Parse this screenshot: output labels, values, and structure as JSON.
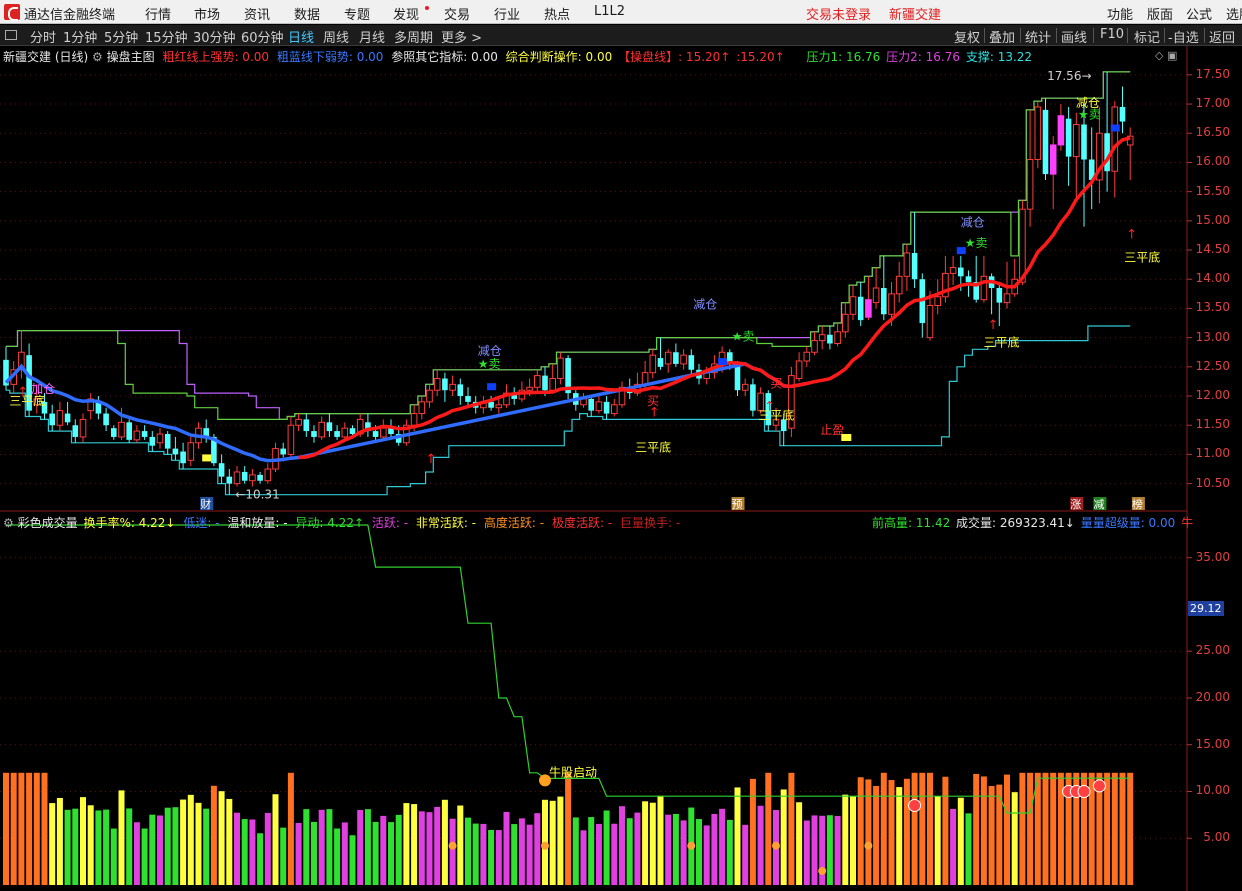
{
  "menu": {
    "app_title": "通达信金融终端",
    "items": [
      "行情",
      "市场",
      "资讯",
      "数据",
      "专题",
      "发现",
      "交易",
      "行业",
      "热点",
      "L1L2"
    ],
    "login_status": "交易未登录",
    "stock_name": "新疆交建",
    "right_items": [
      "功能",
      "版面",
      "公式",
      "选股"
    ]
  },
  "period": {
    "tabs": [
      "分时",
      "1分钟",
      "5分钟",
      "15分钟",
      "30分钟",
      "60分钟",
      "日线",
      "周线",
      "月线",
      "多周期",
      "更多 >"
    ],
    "active": "日线",
    "right_buttons": [
      "复权",
      "叠加",
      "统计",
      "画线",
      "F10",
      "标记",
      "-自选",
      "返回"
    ]
  },
  "main_legend": {
    "stock_title": "新疆交建 (日线)",
    "indicator_name": "操盘主图",
    "items": [
      {
        "text": "粗红线上强势: 0.00",
        "color": "#ff3030"
      },
      {
        "text": "粗蓝线下弱势: 0.00",
        "color": "#3a78ff"
      },
      {
        "text": "参照其它指标: 0.00",
        "color": "#e8e8e8"
      },
      {
        "text": "综合判断操作: 0.00",
        "color": "#ffff40"
      },
      {
        "text": "【操盘线】: 15.20↑",
        "color": "#ff3030"
      },
      {
        "text": ":15.20↑",
        "color": "#ff3030"
      },
      {
        "text": "压力1: 16.76",
        "color": "#30e030"
      },
      {
        "text": "压力2: 16.76",
        "color": "#e040e0"
      },
      {
        "text": "支撑: 13.22",
        "color": "#30e0e0"
      }
    ]
  },
  "price_axis": [
    "17.50",
    "17.00",
    "16.50",
    "16.00",
    "15.50",
    "15.00",
    "14.50",
    "14.00",
    "13.50",
    "13.00",
    "12.50",
    "12.00",
    "11.50",
    "11.00",
    "10.50"
  ],
  "price_range": [
    10.1,
    17.72
  ],
  "candles": [
    [
      12.62,
      12.18,
      12.85,
      12.1
    ],
    [
      12.2,
      12.45,
      12.6,
      12.05
    ],
    [
      12.45,
      12.75,
      13.12,
      12.3
    ],
    [
      12.7,
      11.75,
      12.9,
      11.65
    ],
    [
      11.85,
      11.95,
      12.2,
      11.7
    ],
    [
      11.9,
      11.7,
      12.05,
      11.6
    ],
    [
      11.7,
      11.5,
      11.85,
      11.4
    ],
    [
      11.5,
      11.75,
      11.9,
      11.4
    ],
    [
      11.7,
      11.55,
      11.9,
      11.5
    ],
    [
      11.5,
      11.3,
      11.6,
      11.2
    ],
    [
      11.3,
      11.6,
      11.7,
      11.2
    ],
    [
      11.75,
      11.95,
      12.05,
      11.6
    ],
    [
      11.9,
      11.7,
      12.0,
      11.6
    ],
    [
      11.7,
      11.5,
      11.8,
      11.4
    ],
    [
      11.45,
      11.3,
      11.5,
      11.25
    ],
    [
      11.3,
      11.55,
      11.8,
      11.25
    ],
    [
      11.55,
      11.25,
      11.6,
      11.2
    ],
    [
      11.25,
      11.4,
      11.5,
      11.2
    ],
    [
      11.4,
      11.3,
      11.5,
      11.25
    ],
    [
      11.3,
      11.15,
      11.4,
      11.05
    ],
    [
      11.2,
      11.35,
      11.45,
      11.1
    ],
    [
      11.35,
      11.1,
      11.4,
      11.0
    ],
    [
      11.1,
      11.0,
      11.3,
      10.9
    ],
    [
      11.05,
      10.85,
      11.2,
      10.75
    ],
    [
      10.9,
      11.2,
      11.3,
      10.8
    ],
    [
      11.2,
      11.45,
      11.55,
      11.1
    ],
    [
      11.45,
      11.3,
      11.6,
      11.2
    ],
    [
      11.3,
      10.85,
      11.35,
      10.8
    ],
    [
      10.85,
      10.62,
      11.0,
      10.5
    ],
    [
      10.62,
      10.5,
      10.75,
      10.31
    ],
    [
      10.5,
      10.7,
      10.8,
      10.45
    ],
    [
      10.7,
      10.55,
      10.8,
      10.5
    ],
    [
      10.55,
      10.65,
      10.75,
      10.45
    ],
    [
      10.65,
      10.55,
      10.7,
      10.5
    ],
    [
      10.55,
      10.75,
      10.85,
      10.5
    ],
    [
      10.75,
      11.1,
      11.2,
      10.7
    ],
    [
      11.1,
      11.0,
      11.2,
      10.95
    ],
    [
      11.0,
      11.5,
      11.65,
      10.95
    ],
    [
      11.5,
      11.6,
      11.7,
      11.4
    ],
    [
      11.6,
      11.4,
      11.7,
      11.3
    ],
    [
      11.4,
      11.3,
      11.5,
      11.2
    ],
    [
      11.3,
      11.55,
      11.65,
      11.25
    ],
    [
      11.55,
      11.4,
      11.7,
      11.3
    ],
    [
      11.4,
      11.3,
      11.5,
      11.25
    ],
    [
      11.3,
      11.45,
      11.55,
      11.25
    ],
    [
      11.45,
      11.35,
      11.5,
      11.3
    ],
    [
      11.35,
      11.6,
      11.7,
      11.3
    ],
    [
      11.55,
      11.4,
      11.7,
      11.3
    ],
    [
      11.4,
      11.3,
      11.5,
      11.2
    ],
    [
      11.3,
      11.45,
      11.6,
      11.25
    ],
    [
      11.45,
      11.35,
      11.6,
      11.3
    ],
    [
      11.35,
      11.2,
      11.5,
      11.15
    ],
    [
      11.2,
      11.5,
      11.6,
      11.15
    ],
    [
      11.5,
      11.7,
      11.85,
      11.4
    ],
    [
      11.7,
      11.9,
      12.0,
      11.6
    ],
    [
      11.9,
      12.1,
      12.2,
      11.8
    ],
    [
      12.1,
      12.3,
      12.45,
      12.0
    ],
    [
      12.3,
      12.1,
      12.4,
      11.9
    ],
    [
      12.1,
      12.2,
      12.35,
      12.0
    ],
    [
      12.2,
      12.0,
      12.3,
      11.85
    ],
    [
      12.0,
      11.9,
      12.15,
      11.8
    ],
    [
      11.9,
      11.8,
      12.0,
      11.7
    ],
    [
      11.8,
      11.9,
      12.0,
      11.7
    ],
    [
      11.9,
      11.8,
      12.0,
      11.75
    ],
    [
      11.8,
      11.85,
      11.95,
      11.7
    ],
    [
      11.85,
      12.05,
      12.2,
      11.8
    ],
    [
      12.05,
      11.95,
      12.15,
      11.85
    ],
    [
      11.95,
      12.1,
      12.25,
      11.9
    ],
    [
      12.1,
      12.15,
      12.3,
      12.0
    ],
    [
      12.15,
      12.35,
      12.45,
      12.05
    ],
    [
      12.35,
      12.1,
      12.5,
      12.0
    ],
    [
      12.1,
      12.3,
      12.55,
      12.05
    ],
    [
      12.3,
      12.65,
      12.75,
      12.2
    ],
    [
      12.65,
      12.05,
      12.7,
      11.95
    ],
    [
      12.05,
      11.85,
      12.1,
      11.75
    ],
    [
      11.85,
      11.95,
      12.05,
      11.8
    ],
    [
      11.95,
      11.75,
      12.0,
      11.65
    ],
    [
      11.75,
      11.9,
      12.0,
      11.7
    ],
    [
      11.9,
      11.7,
      12.0,
      11.6
    ],
    [
      11.7,
      11.85,
      11.95,
      11.65
    ],
    [
      11.85,
      12.15,
      12.25,
      11.8
    ],
    [
      12.15,
      12.05,
      12.3,
      11.95
    ],
    [
      12.05,
      12.2,
      12.4,
      12.0
    ],
    [
      12.2,
      12.4,
      12.6,
      12.1
    ],
    [
      12.4,
      12.7,
      12.8,
      12.3
    ],
    [
      12.65,
      12.5,
      13.0,
      12.45
    ],
    [
      12.55,
      12.75,
      12.8,
      12.4
    ],
    [
      12.75,
      12.55,
      12.9,
      12.5
    ],
    [
      12.55,
      12.7,
      12.8,
      12.45
    ],
    [
      12.7,
      12.45,
      12.8,
      12.35
    ],
    [
      12.45,
      12.3,
      12.55,
      12.2
    ],
    [
      12.3,
      12.4,
      12.5,
      12.2
    ],
    [
      12.4,
      12.55,
      12.7,
      12.3
    ],
    [
      12.55,
      12.75,
      12.85,
      12.4
    ],
    [
      12.75,
      12.55,
      12.8,
      12.45
    ],
    [
      12.55,
      12.1,
      12.6,
      12.0
    ],
    [
      12.1,
      12.2,
      12.3,
      12.0
    ],
    [
      12.2,
      11.75,
      12.3,
      11.65
    ],
    [
      11.75,
      12.05,
      12.15,
      11.7
    ],
    [
      12.05,
      11.5,
      12.1,
      11.4
    ],
    [
      11.5,
      11.6,
      11.8,
      11.4
    ],
    [
      11.6,
      11.4,
      11.7,
      11.15
    ],
    [
      11.45,
      12.35,
      12.5,
      11.3
    ],
    [
      12.3,
      12.6,
      12.75,
      12.25
    ],
    [
      12.6,
      12.75,
      12.85,
      12.5
    ],
    [
      12.75,
      12.95,
      13.1,
      12.7
    ],
    [
      12.95,
      13.05,
      13.2,
      12.8
    ],
    [
      13.05,
      12.9,
      13.2,
      12.8
    ],
    [
      12.9,
      13.1,
      13.25,
      12.85
    ],
    [
      13.1,
      13.4,
      13.6,
      13.0
    ],
    [
      13.4,
      13.7,
      13.9,
      13.3
    ],
    [
      13.7,
      13.3,
      13.95,
      13.2
    ],
    [
      13.35,
      13.65,
      14.05,
      13.3
    ],
    [
      13.6,
      13.85,
      14.2,
      13.5
    ],
    [
      13.85,
      13.4,
      14.4,
      13.3
    ],
    [
      13.4,
      13.75,
      13.95,
      13.2
    ],
    [
      13.75,
      14.05,
      14.3,
      13.6
    ],
    [
      14.05,
      14.45,
      14.6,
      13.8
    ],
    [
      14.45,
      14.0,
      15.15,
      13.85
    ],
    [
      14.0,
      13.25,
      14.1,
      13.0
    ],
    [
      13.0,
      13.55,
      13.8,
      12.95
    ],
    [
      13.55,
      13.7,
      14.0,
      13.4
    ],
    [
      13.7,
      14.1,
      14.4,
      13.6
    ],
    [
      14.1,
      14.2,
      14.4,
      13.9
    ],
    [
      14.2,
      14.05,
      14.4,
      13.8
    ],
    [
      14.05,
      13.95,
      14.15,
      13.7
    ],
    [
      13.95,
      13.65,
      14.4,
      13.6
    ],
    [
      13.65,
      14.05,
      14.4,
      13.6
    ],
    [
      14.05,
      13.85,
      14.1,
      13.4
    ],
    [
      13.85,
      13.6,
      13.9,
      13.2
    ],
    [
      13.6,
      13.75,
      14.3,
      13.5
    ],
    [
      13.75,
      14.0,
      14.35,
      13.7
    ],
    [
      13.95,
      15.2,
      15.35,
      13.9
    ],
    [
      15.2,
      16.05,
      16.9,
      14.9
    ],
    [
      16.05,
      16.95,
      17.05,
      15.9
    ],
    [
      16.9,
      15.8,
      17.1,
      15.7
    ],
    [
      15.8,
      16.3,
      16.45,
      15.2
    ],
    [
      16.3,
      16.8,
      17.0,
      16.2
    ],
    [
      16.75,
      16.1,
      16.95,
      15.6
    ],
    [
      16.1,
      16.65,
      16.85,
      15.4
    ],
    [
      16.65,
      16.05,
      17.0,
      14.9
    ],
    [
      16.05,
      15.7,
      16.6,
      15.2
    ],
    [
      15.7,
      16.5,
      16.95,
      15.3
    ],
    [
      16.5,
      15.85,
      17.55,
      15.5
    ],
    [
      15.85,
      16.95,
      17.05,
      15.4
    ],
    [
      16.95,
      16.7,
      17.3,
      16.5
    ],
    [
      16.3,
      16.45,
      16.6,
      15.7
    ]
  ],
  "volume_axis": [
    "35.00",
    "25.00",
    "20.00",
    "15.00",
    "10.00",
    "5.00"
  ],
  "volume_range": [
    0,
    38.5
  ],
  "volume_current_label": "29.12",
  "volume_legend": {
    "indicator_name": "彩色成交量",
    "items": [
      {
        "text": "换手率%: 4.22↓",
        "color": "#ffff40"
      },
      {
        "text": "低迷: -",
        "color": "#3a78ff"
      },
      {
        "text": "温和放量: -",
        "color": "#e8e8e8"
      },
      {
        "text": "异动: 4.22↑",
        "color": "#30e030"
      },
      {
        "text": "活跃: -",
        "color": "#e040e0"
      },
      {
        "text": "非常活跃: -",
        "color": "#ffff40"
      },
      {
        "text": "高度活跃: -",
        "color": "#ff9020"
      },
      {
        "text": "极度活跃: -",
        "color": "#ff3030"
      },
      {
        "text": "巨量换手: -",
        "color": "#c02020"
      }
    ],
    "right_items": [
      {
        "text": "前高量: 11.42",
        "color": "#30e030"
      },
      {
        "text": "成交量: 269323.41↓",
        "color": "#e8e8e8"
      },
      {
        "text": "量量超级量: 0.00",
        "color": "#3a78ff"
      },
      {
        "text": "牛",
        "color": "#ff3030"
      }
    ]
  },
  "annotations": {
    "low_price_label": "10.31",
    "high_price_label": "17.56",
    "add_position": "加仓",
    "three_bottom": "三平底",
    "reduce_position": "减仓",
    "sell": "卖",
    "buy": "买",
    "stop_profit": "止盈",
    "strong_bull_start": "牛股启动",
    "marker_cai": "财",
    "marker_yu": "预",
    "marker_zhang": "涨",
    "marker_jian": "减",
    "marker_bang": "榜"
  }
}
